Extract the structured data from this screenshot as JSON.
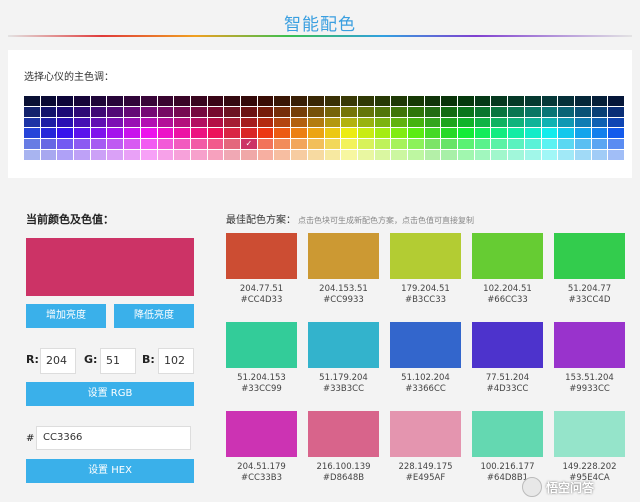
{
  "header": {
    "title": "智能配色"
  },
  "picker": {
    "label": "选择心仪的主色调：",
    "selected_color": "#CC3366",
    "check_mark": "✓"
  },
  "current": {
    "label": "当前颜色及色值：",
    "color": "#CC3366",
    "increase_label": "增加亮度",
    "decrease_label": "降低亮度",
    "r_label": "R:",
    "g_label": "G:",
    "b_label": "B:",
    "r": "204",
    "g": "51",
    "b": "102",
    "set_rgb_label": "设置 RGB",
    "hash": "#",
    "hex": "CC3366",
    "set_hex_label": "设置 HEX"
  },
  "best": {
    "label": "最佳配色方案：",
    "hint": "点击色块可生成新配色方案，点击色值可直接复制"
  },
  "schemes": [
    {
      "rgb": "204.77.51",
      "hex": "#CC4D33",
      "color": "#CC4D33"
    },
    {
      "rgb": "204.153.51",
      "hex": "#CC9933",
      "color": "#CC9933"
    },
    {
      "rgb": "179.204.51",
      "hex": "#B3CC33",
      "color": "#B3CC33"
    },
    {
      "rgb": "102.204.51",
      "hex": "#66CC33",
      "color": "#66CC33"
    },
    {
      "rgb": "51.204.77",
      "hex": "#33CC4D",
      "color": "#33CC4D"
    },
    {
      "rgb": "51.204.153",
      "hex": "#33CC99",
      "color": "#33CC99"
    },
    {
      "rgb": "51.179.204",
      "hex": "#33B3CC",
      "color": "#33B3CC"
    },
    {
      "rgb": "51.102.204",
      "hex": "#3366CC",
      "color": "#3366CC"
    },
    {
      "rgb": "77.51.204",
      "hex": "#4D33CC",
      "color": "#4D33CC"
    },
    {
      "rgb": "153.51.204",
      "hex": "#9933CC",
      "color": "#9933CC"
    },
    {
      "rgb": "204.51.179",
      "hex": "#CC33B3",
      "color": "#CC33B3"
    },
    {
      "rgb": "216.100.139",
      "hex": "#D8648B",
      "color": "#D8648B"
    },
    {
      "rgb": "228.149.175",
      "hex": "#E495AF",
      "color": "#E495AF"
    },
    {
      "rgb": "100.216.177",
      "hex": "#64D8B1",
      "color": "#64D8B1"
    },
    {
      "rgb": "149.228.202",
      "hex": "#95E4CA",
      "color": "#95E4CA"
    }
  ],
  "watermark": {
    "text": "悟空问答"
  }
}
